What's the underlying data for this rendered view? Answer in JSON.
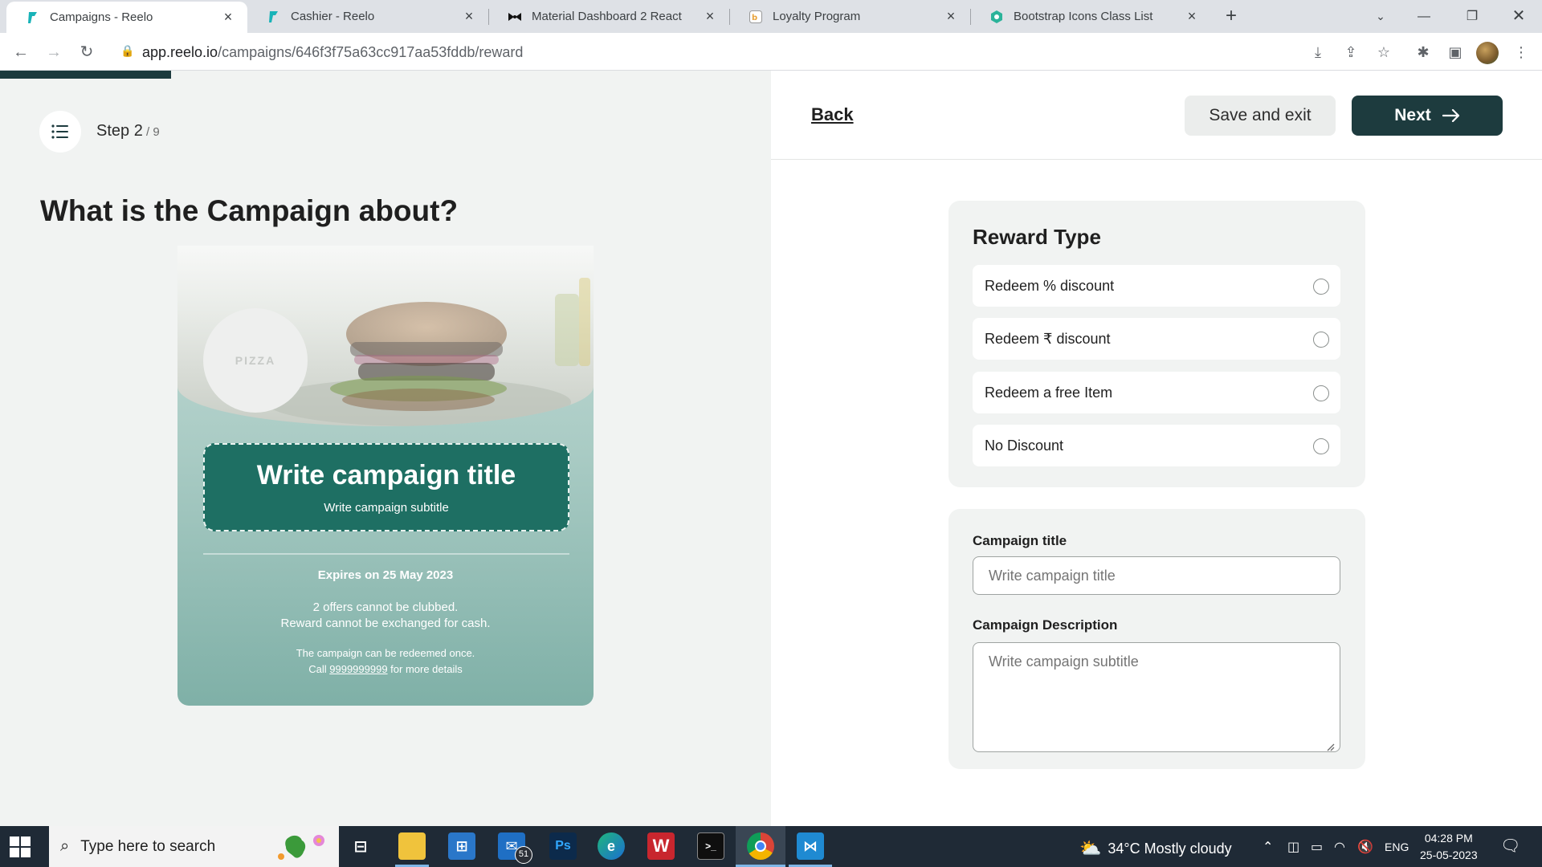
{
  "browser": {
    "tabs": [
      {
        "title": "Campaigns - Reelo",
        "active": true
      },
      {
        "title": "Cashier - Reelo",
        "active": false
      },
      {
        "title": "Material Dashboard 2 React",
        "active": false
      },
      {
        "title": "Loyalty Program",
        "active": false
      },
      {
        "title": "Bootstrap Icons Class List",
        "active": false
      }
    ],
    "url_host": "app.reelo.io",
    "url_path": "/campaigns/646f3f75a63cc917aa53fddb/reward"
  },
  "wizard": {
    "step_label": "Step 2",
    "step_total": " / 9",
    "progress_fraction": 0.111,
    "page_title": "What is the Campaign about?"
  },
  "preview": {
    "logo_text": "PIZZA",
    "title": "Write campaign title",
    "subtitle": "Write campaign subtitle",
    "expires": "Expires on 25 May 2023",
    "terms_line1": "2 offers cannot be clubbed.",
    "terms_line2": "Reward cannot be exchanged for cash.",
    "redeem_line1": "The campaign can be redeemed once.",
    "redeem_line2_prefix": "Call ",
    "phone": "9999999999",
    "redeem_line2_suffix": " for more details"
  },
  "header": {
    "back_label": "Back",
    "save_label": "Save and exit",
    "next_label": "Next"
  },
  "reward_type": {
    "heading": "Reward Type",
    "options": [
      {
        "label": "Redeem % discount",
        "selected": false
      },
      {
        "label": "Redeem ₹ discount",
        "selected": false
      },
      {
        "label": "Redeem a free Item",
        "selected": false
      },
      {
        "label": "No Discount",
        "selected": false
      }
    ]
  },
  "form": {
    "title_label": "Campaign title",
    "title_placeholder": "Write campaign title",
    "description_label": "Campaign Description",
    "description_placeholder": "Write campaign subtitle"
  },
  "taskbar": {
    "search_placeholder": "Type here to search",
    "mail_badge": "51",
    "weather": "34°C  Mostly cloudy",
    "language": "ENG",
    "time": "04:28 PM",
    "date": "25-05-2023"
  },
  "colors": {
    "accent_dark": "#1d3b3e",
    "card_teal": "#1e6f63"
  }
}
